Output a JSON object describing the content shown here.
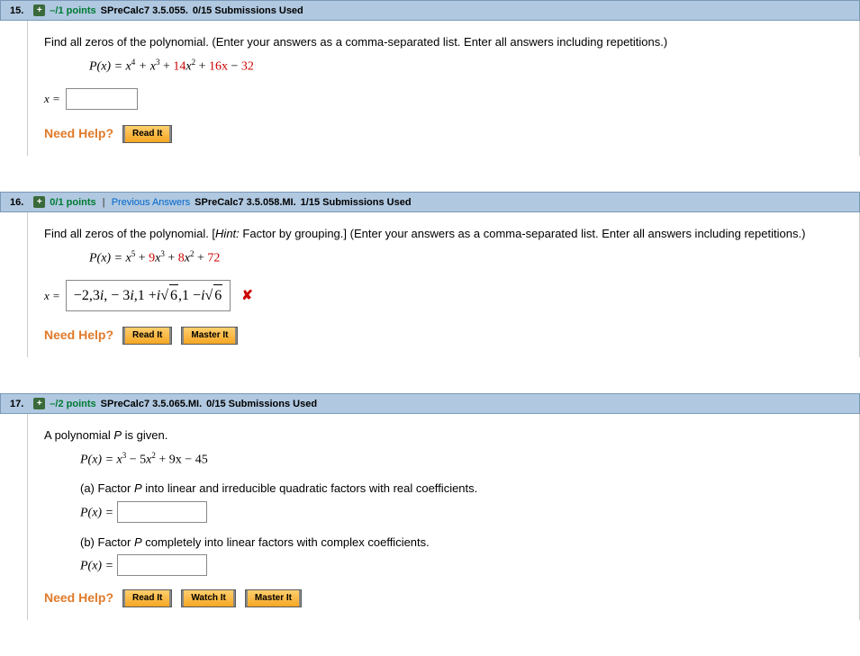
{
  "q15": {
    "number": "15.",
    "points": "–/1 points",
    "ref": "SPreCalc7 3.5.055.",
    "submissions": "0/15 Submissions Used",
    "prompt": "Find all zeros of the polynomial. (Enter your answers as a comma-separated list. Enter all answers including repetitions.)",
    "formula_prefix": "P(x) = x",
    "formula_mid1": " + x",
    "formula_mid2": " + ",
    "coef_14": "14",
    "formula_x2": "x",
    "formula_plus2": " + ",
    "coef_16x": "16x",
    "formula_minus": " − ",
    "coef_32": "32",
    "answer_label": "x =",
    "need_help": "Need Help?",
    "read_it": "Read It"
  },
  "q16": {
    "number": "16.",
    "points": "0/1 points",
    "prev_answers": "Previous Answers",
    "ref": "SPreCalc7 3.5.058.MI.",
    "submissions": "1/15 Submissions Used",
    "prompt_a": "Find all zeros of the polynomial. [",
    "hint": "Hint:",
    "prompt_b": " Factor by grouping.] (Enter your answers as a comma-separated list. Enter all answers including repetitions.)",
    "formula_prefix": "P(x) = x",
    "formula_plus1": " + ",
    "coef_9": "9",
    "formula_x3": "x",
    "formula_plus2": " + ",
    "coef_8": "8",
    "formula_x2": "x",
    "formula_plus3": " + ",
    "coef_72": "72",
    "answer_label": "x =",
    "answer_value": "−2,3i, − 3i,1 + i√6 ,1 − i√6",
    "need_help": "Need Help?",
    "read_it": "Read It",
    "master_it": "Master It"
  },
  "q17": {
    "number": "17.",
    "points": "–/2 points",
    "ref": "SPreCalc7 3.5.065.MI.",
    "submissions": "0/15 Submissions Used",
    "prompt": "A polynomial P is given.",
    "formula_prefix": "P(x) = x",
    "formula_minus1": " − ",
    "coef_5": "5",
    "formula_x2": "x",
    "formula_plus": " + ",
    "coef_9x": "9x",
    "formula_minus2": " − ",
    "coef_45": "45",
    "part_a": "(a) Factor P into linear and irreducible quadratic factors with real coefficients.",
    "part_b": "(b) Factor P completely into linear factors with complex coefficients.",
    "px_label": "P(x) =",
    "need_help": "Need Help?",
    "read_it": "Read It",
    "watch_it": "Watch It",
    "master_it": "Master It"
  }
}
